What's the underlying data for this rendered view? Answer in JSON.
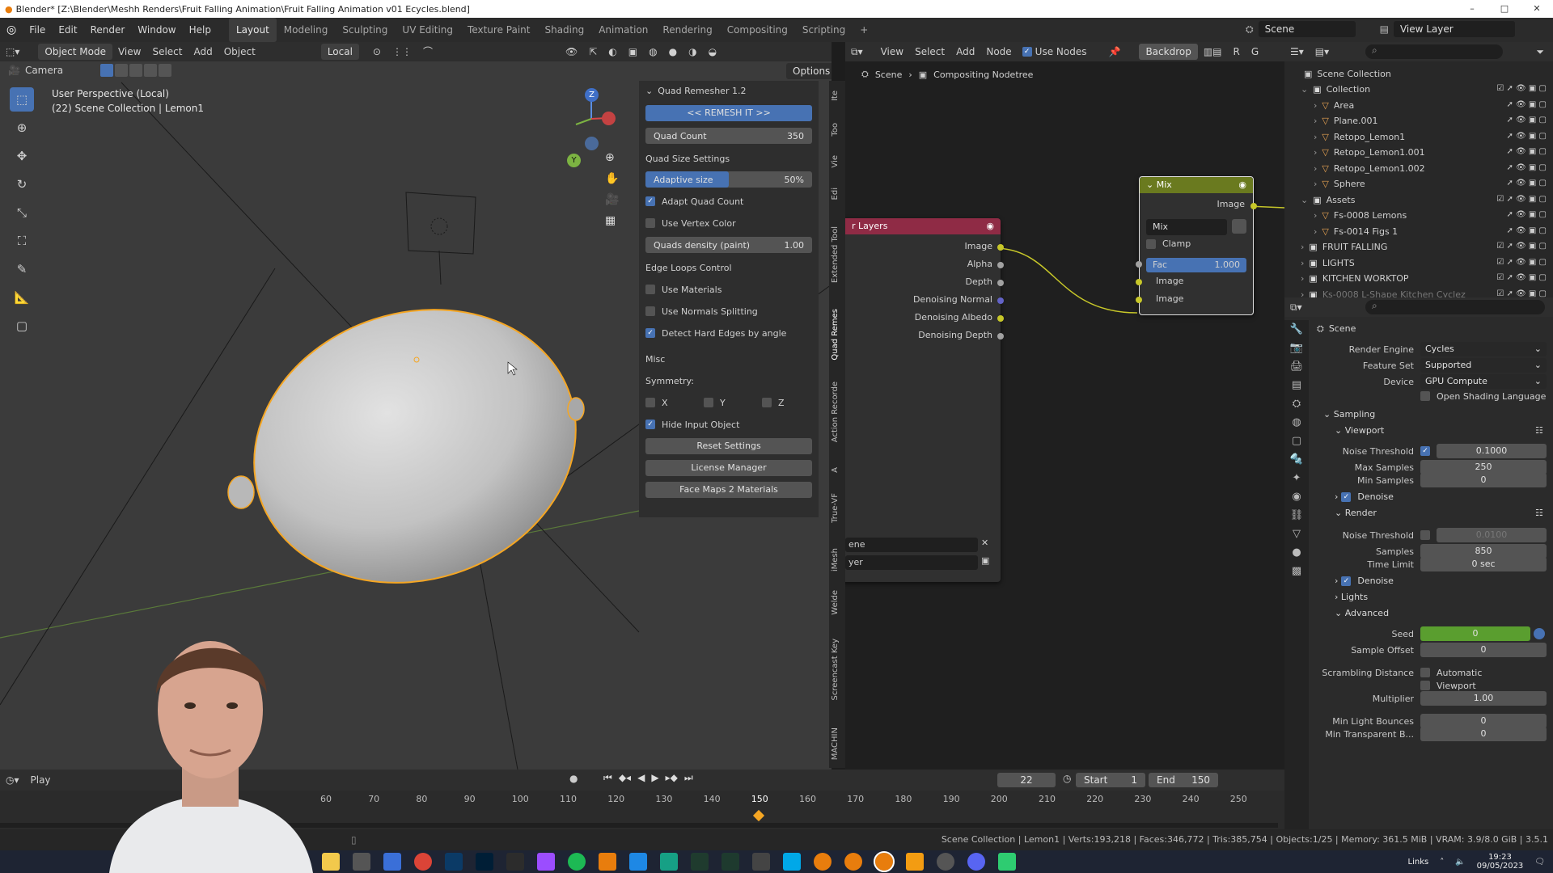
{
  "window": {
    "title": "Blender* [Z:\\Blender\\Meshh Renders\\Fruit Falling Animation\\Fruit Falling Animation v01 Ecycles.blend]",
    "controls": [
      "–",
      "□",
      "✕"
    ]
  },
  "menubar": {
    "menus": [
      "File",
      "Edit",
      "Render",
      "Window",
      "Help"
    ],
    "workspaces": [
      "Layout",
      "Modeling",
      "Sculpting",
      "UV Editing",
      "Texture Paint",
      "Shading",
      "Animation",
      "Rendering",
      "Compositing",
      "Scripting"
    ],
    "active_workspace": "Layout",
    "add_tab": "+",
    "scene": "Scene",
    "view_layer": "View Layer"
  },
  "viewport": {
    "mode": "Object Mode",
    "menus": [
      "View",
      "Select",
      "Add",
      "Object"
    ],
    "transform_orientation": "Local",
    "camera_label": "Camera",
    "options_label": "Options",
    "overlay_line1": "User Perspective (Local)",
    "overlay_line2": "(22) Scene Collection | Lemon1",
    "gizmo": {
      "z": "Z",
      "y": "Y",
      "x": "X"
    }
  },
  "tools": [
    "select-box-icon",
    "cursor-icon",
    "move-icon",
    "rotate-icon",
    "scale-icon",
    "transform-icon",
    "annotate-icon",
    "measure-icon",
    "add-cube-icon"
  ],
  "quad_remesher": {
    "title": "Quad Remesher 1.2",
    "remesh_button": "<< REMESH IT >>",
    "quad_count_label": "Quad Count",
    "quad_count_value": "350",
    "size_section": "Quad Size Settings",
    "adaptive_size_label": "Adaptive size",
    "adaptive_size_value": "50%",
    "adaptive_size_fraction": 0.5,
    "adapt_quad_count": "Adapt Quad Count",
    "use_vertex_color": "Use Vertex Color",
    "quads_density_label": "Quads density (paint)",
    "quads_density_value": "1.00",
    "edge_section": "Edge Loops Control",
    "use_materials": "Use Materials",
    "use_normals_splitting": "Use Normals Splitting",
    "detect_hard_edges": "Detect Hard Edges by angle",
    "misc_section": "Misc",
    "symmetry_label": "Symmetry:",
    "sym_x": "X",
    "sym_y": "Y",
    "sym_z": "Z",
    "hide_input": "Hide Input Object",
    "reset_settings": "Reset Settings",
    "license_manager": "License Manager",
    "face_maps": "Face Maps 2 Materials"
  },
  "sidebar_tabs": [
    "Ite",
    "Too",
    "Vie",
    "Edi",
    "Extended Tool",
    "Quad Remes",
    "Action Recorde",
    "A",
    "True-VF",
    "iMesh",
    "Welde",
    "Screencast Key",
    "MACHIN"
  ],
  "node_editor": {
    "menus": [
      "View",
      "Select",
      "Add",
      "Node"
    ],
    "use_nodes": "Use Nodes",
    "backdrop": "Backdrop",
    "channels": [
      "R",
      "G"
    ],
    "breadcrumb_scene": "Scene",
    "breadcrumb_tree": "Compositing Nodetree",
    "render_layers": {
      "title": "r Layers",
      "outputs": [
        "Image",
        "Alpha",
        "Depth",
        "Denoising Normal",
        "Denoising Albedo",
        "Denoising Depth"
      ],
      "scene_field": "ene",
      "layer_field": "yer"
    },
    "mix_node": {
      "title": "Mix",
      "output": "Image",
      "blend_mode": "Mix",
      "clamp": "Clamp",
      "fac_label": "Fac",
      "fac_value": "1.000",
      "inputs": [
        "Image",
        "Image"
      ]
    }
  },
  "outliner": {
    "root": "Scene Collection",
    "items": [
      {
        "label": "Collection",
        "level": 1
      },
      {
        "label": "Area",
        "level": 2
      },
      {
        "label": "Plane.001",
        "level": 2
      },
      {
        "label": "Retopo_Lemon1",
        "level": 2
      },
      {
        "label": "Retopo_Lemon1.001",
        "level": 2
      },
      {
        "label": "Retopo_Lemon1.002",
        "level": 2
      },
      {
        "label": "Sphere",
        "level": 2
      },
      {
        "label": "Assets",
        "level": 1
      },
      {
        "label": "Fs-0008 Lemons",
        "level": 2
      },
      {
        "label": "Fs-0014 Figs 1",
        "level": 2
      },
      {
        "label": "FRUIT FALLING",
        "level": 1
      },
      {
        "label": "LIGHTS",
        "level": 1
      },
      {
        "label": "KITCHEN WORKTOP",
        "level": 1
      },
      {
        "label": "Ks-0008 L-Shape Kitchen Cyclez",
        "level": 1
      }
    ]
  },
  "properties": {
    "scene_name": "Scene",
    "render_engine_label": "Render Engine",
    "render_engine": "Cycles",
    "feature_set_label": "Feature Set",
    "feature_set": "Supported",
    "device_label": "Device",
    "device": "GPU Compute",
    "osl": "Open Shading Language",
    "sampling": "Sampling",
    "viewport": "Viewport",
    "noise_threshold_label": "Noise Threshold",
    "vp_noise_threshold": "0.1000",
    "max_samples_label": "Max Samples",
    "vp_max_samples": "250",
    "min_samples_label": "Min Samples",
    "vp_min_samples": "0",
    "denoise": "Denoise",
    "render": "Render",
    "r_noise_threshold": "0.0100",
    "samples_label": "Samples",
    "r_samples": "850",
    "time_limit_label": "Time Limit",
    "r_time_limit": "0 sec",
    "lights": "Lights",
    "advanced": "Advanced",
    "seed_label": "Seed",
    "seed": "0",
    "sample_offset_label": "Sample Offset",
    "sample_offset": "0",
    "scrambling_label": "Scrambling Distance",
    "automatic": "Automatic",
    "viewport_chk": "Viewport",
    "multiplier_label": "Multiplier",
    "multiplier": "1.00",
    "min_light_bounces_label": "Min Light Bounces",
    "min_light_bounces": "0",
    "min_transparent_label": "Min Transparent B...",
    "min_transparent": "0"
  },
  "timeline": {
    "playback": "Play",
    "current_frame": "22",
    "start_label": "Start",
    "start": "1",
    "end_label": "End",
    "end": "150",
    "ticks": [
      "60",
      "70",
      "80",
      "90",
      "100",
      "110",
      "120",
      "130",
      "140",
      "150",
      "160",
      "170",
      "180",
      "190",
      "200",
      "210",
      "220",
      "230",
      "240",
      "250"
    ]
  },
  "status": {
    "text": "Scene Collection | Lemon1 | Verts:193,218 | Faces:346,772 | Tris:385,754 | Objects:1/25 | Memory: 361.5 MiB | VRAM: 3.9/8.0 GiB | 3.5.1"
  },
  "taskbar": {
    "links": "Links",
    "time": "19:23",
    "date": "09/05/2023"
  },
  "colors": {
    "accent": "#4772b3",
    "selection_outline": "#f5a623",
    "render_layers_header": "#8f2b45",
    "mix_header": "#6a7a1f",
    "seed_green": "#5a9e2f"
  }
}
